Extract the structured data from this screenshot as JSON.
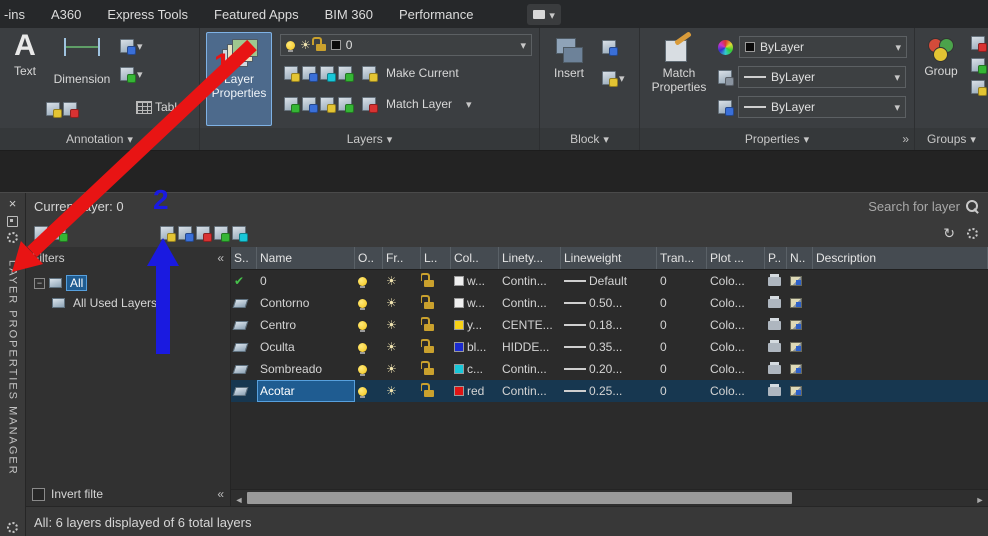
{
  "menubar": {
    "tabs": [
      "-ins",
      "A360",
      "Express Tools",
      "Featured Apps",
      "BIM 360",
      "Performance"
    ]
  },
  "ribbon": {
    "annotation": {
      "caption": "Annotation",
      "text_label": "Text",
      "dimension_label": "Dimension",
      "table_label": "Table"
    },
    "layers": {
      "caption": "Layers",
      "layer_properties_label": "Layer Properties",
      "layer_combo_value": "0",
      "make_current_label": "Make Current",
      "match_layer_label": "Match Layer"
    },
    "block": {
      "caption": "Block",
      "insert_label": "Insert"
    },
    "properties": {
      "caption": "Properties",
      "match_properties_label": "Match Properties",
      "color_value": "ByLayer",
      "lineweight_value": "ByLayer",
      "linetype_value": "ByLayer"
    },
    "groups": {
      "caption": "Groups",
      "group_label": "Group"
    }
  },
  "palette": {
    "title_vertical": "LAYER PROPERTIES MANAGER",
    "current_layer_label": "Current layer: 0",
    "search_placeholder": "Search for layer",
    "filters": {
      "header": "Filters",
      "items": [
        {
          "label": "All",
          "selected": true,
          "indent": 0,
          "expander": true
        },
        {
          "label": "All Used Layers",
          "selected": false,
          "indent": 1,
          "expander": false
        }
      ],
      "invert_label": "Invert filte"
    },
    "table": {
      "columns": [
        "S..",
        "Name",
        "O..",
        "Fr..",
        "L..",
        "Col..",
        "Linety...",
        "Lineweight",
        "Tran...",
        "Plot ...",
        "P..",
        "N..",
        "Description"
      ],
      "rows": [
        {
          "status": "current",
          "name": "0",
          "color_swatch": "#f0f0f0",
          "color": "w...",
          "linetype": "Contin...",
          "lineweight": "Default",
          "transparency": "0",
          "plot_style": "Colo...",
          "selected": false
        },
        {
          "status": "layer",
          "name": "Contorno",
          "color_swatch": "#f0f0f0",
          "color": "w...",
          "linetype": "Contin...",
          "lineweight": "0.50...",
          "transparency": "0",
          "plot_style": "Colo...",
          "selected": false
        },
        {
          "status": "layer",
          "name": "Centro",
          "color_swatch": "#f7d117",
          "color": "y...",
          "linetype": "CENTE...",
          "lineweight": "0.18...",
          "transparency": "0",
          "plot_style": "Colo...",
          "selected": false
        },
        {
          "status": "layer",
          "name": "Oculta",
          "color_swatch": "#1b2bd0",
          "color": "bl...",
          "linetype": "HIDDE...",
          "lineweight": "0.35...",
          "transparency": "0",
          "plot_style": "Colo...",
          "selected": false
        },
        {
          "status": "layer",
          "name": "Sombreado",
          "color_swatch": "#18c7d8",
          "color": "c...",
          "linetype": "Contin...",
          "lineweight": "0.20...",
          "transparency": "0",
          "plot_style": "Colo...",
          "selected": false
        },
        {
          "status": "layer",
          "name": "Acotar",
          "color_swatch": "#e01414",
          "color": "red",
          "linetype": "Contin...",
          "lineweight": "0.25...",
          "transparency": "0",
          "plot_style": "Colo...",
          "selected": true
        }
      ]
    },
    "status_text": "All: 6 layers displayed of 6 total layers"
  },
  "annotations": {
    "step1": "1",
    "step2": "2"
  },
  "colors": {
    "annotation_red": "#e81414",
    "annotation_blue": "#1a1ae0",
    "selection_blue": "#1f5c91"
  }
}
